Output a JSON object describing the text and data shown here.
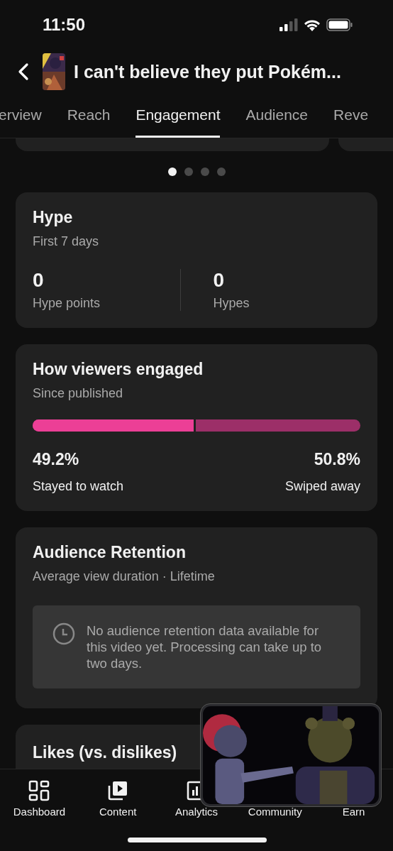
{
  "status_bar": {
    "time": "11:50"
  },
  "header": {
    "title": "I can't believe they put Pokém..."
  },
  "tabs": [
    {
      "label": "erview",
      "selected": false
    },
    {
      "label": "Reach",
      "selected": false
    },
    {
      "label": "Engagement",
      "selected": true
    },
    {
      "label": "Audience",
      "selected": false
    },
    {
      "label": "Reve",
      "selected": false
    }
  ],
  "carousel_dots": [
    {
      "selected": true
    },
    {
      "selected": false
    },
    {
      "selected": false
    },
    {
      "selected": false
    }
  ],
  "hype": {
    "title": "Hype",
    "subtitle": "First 7 days",
    "stats": [
      {
        "value": "0",
        "label": "Hype points"
      },
      {
        "value": "0",
        "label": "Hypes"
      }
    ]
  },
  "engaged": {
    "title": "How viewers engaged",
    "subtitle": "Since published",
    "level": 0.492,
    "stayed": {
      "value": "49.2%",
      "label": "Stayed to watch"
    },
    "swiped": {
      "value": "50.8%",
      "label": "Swiped away"
    }
  },
  "retention": {
    "title": "Audience Retention",
    "subtitle": "Average view duration · Lifetime",
    "notice": "No audience retention data available for this video yet. Processing can take up to two days."
  },
  "likes": {
    "title": "Likes (vs. dislikes)"
  },
  "nav": [
    {
      "label": "Dashboard"
    },
    {
      "label": "Content"
    },
    {
      "label": "Analytics"
    },
    {
      "label": "Community"
    },
    {
      "label": "Earn"
    }
  ]
}
